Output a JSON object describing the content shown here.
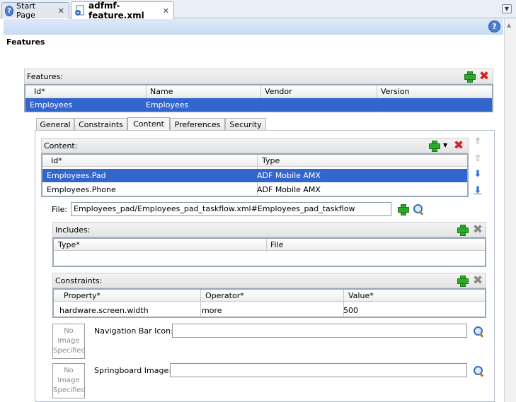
{
  "tabs": [
    {
      "label": "Start Page",
      "active": false
    },
    {
      "label": "adfmf-feature.xml",
      "active": true
    }
  ],
  "page_title": "Features",
  "features_panel": {
    "title": "Features:",
    "columns": [
      "Id*",
      "Name",
      "Vendor",
      "Version"
    ],
    "rows": [
      {
        "id": "Employees",
        "name": "Employees",
        "vendor": "",
        "version": "",
        "selected": true
      }
    ]
  },
  "subtabs": [
    {
      "label": "General",
      "active": false
    },
    {
      "label": "Constraints",
      "active": false
    },
    {
      "label": "Content",
      "active": true
    },
    {
      "label": "Preferences",
      "active": false
    },
    {
      "label": "Security",
      "active": false
    }
  ],
  "content_panel": {
    "title": "Content:",
    "columns": [
      "Id*",
      "Type"
    ],
    "rows": [
      {
        "id": "Employees.Pad",
        "type": "ADF Mobile AMX",
        "selected": true
      },
      {
        "id": "Employees.Phone",
        "type": "ADF Mobile AMX",
        "selected": false
      }
    ]
  },
  "file": {
    "label": "File:",
    "value": "Employees_pad/Employees_pad_taskflow.xml#Employees_pad_taskflow"
  },
  "includes_panel": {
    "title": "Includes:",
    "columns": [
      "Type*",
      "File"
    ]
  },
  "constraints_panel": {
    "title": "Constraints:",
    "columns": [
      "Property*",
      "Operator*",
      "Value*"
    ],
    "rows": [
      {
        "property": "hardware.screen.width",
        "operator": "more",
        "value": "500"
      }
    ]
  },
  "nav_bar_icon": {
    "label": "Navigation Bar Icon:",
    "value": "",
    "placeholder_lines": [
      "No",
      "Image",
      "Specified"
    ]
  },
  "springboard_image": {
    "label": "Springboard Image:",
    "value": "",
    "placeholder_lines": [
      "No",
      "Image",
      "Specified"
    ]
  },
  "colors": {
    "selection": "#3366cc",
    "add": "#2fa82b",
    "delete": "#d42020",
    "help_bar": "#dce9f9"
  },
  "icons": [
    "help-icon",
    "xml-file-icon",
    "close-icon",
    "add-icon",
    "delete-icon",
    "search-icon",
    "move-up-icon",
    "move-down-icon",
    "move-top-icon",
    "move-bottom-icon"
  ]
}
